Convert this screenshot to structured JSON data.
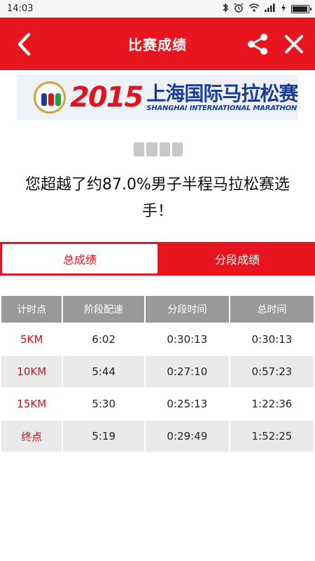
{
  "status_bar": {
    "time": "14:03"
  },
  "app_bar": {
    "title": "比赛成绩"
  },
  "banner": {
    "year": "2015",
    "name_cn": "上海国际马拉松赛",
    "name_en": "SHANGHAI INTERNATIONAL MARATHON"
  },
  "result": {
    "message": "您超越了约87.0%男子半程马拉松赛选手！"
  },
  "tabs": [
    {
      "label": "总成绩",
      "active": true
    },
    {
      "label": "分段成绩",
      "active": false
    }
  ],
  "table": {
    "headers": [
      "计时点",
      "阶段配速",
      "分段时间",
      "总时间"
    ],
    "rows": [
      [
        "5KM",
        "6:02",
        "0:30:13",
        "0:30:13"
      ],
      [
        "10KM",
        "5:44",
        "0:27:10",
        "0:57:23"
      ],
      [
        "15KM",
        "5:30",
        "0:25:13",
        "1:22:36"
      ],
      [
        "终点",
        "5:19",
        "0:29:49",
        "1:52:25"
      ]
    ]
  },
  "colors": {
    "accent": "#e8141e",
    "header_gray": "#999999",
    "row_gray": "#eaeaea"
  },
  "icons": [
    "back-icon",
    "share-icon",
    "close-icon",
    "bluetooth-icon",
    "alarm-icon",
    "wifi-icon",
    "signal-icon",
    "charging-icon",
    "battery-icon"
  ]
}
